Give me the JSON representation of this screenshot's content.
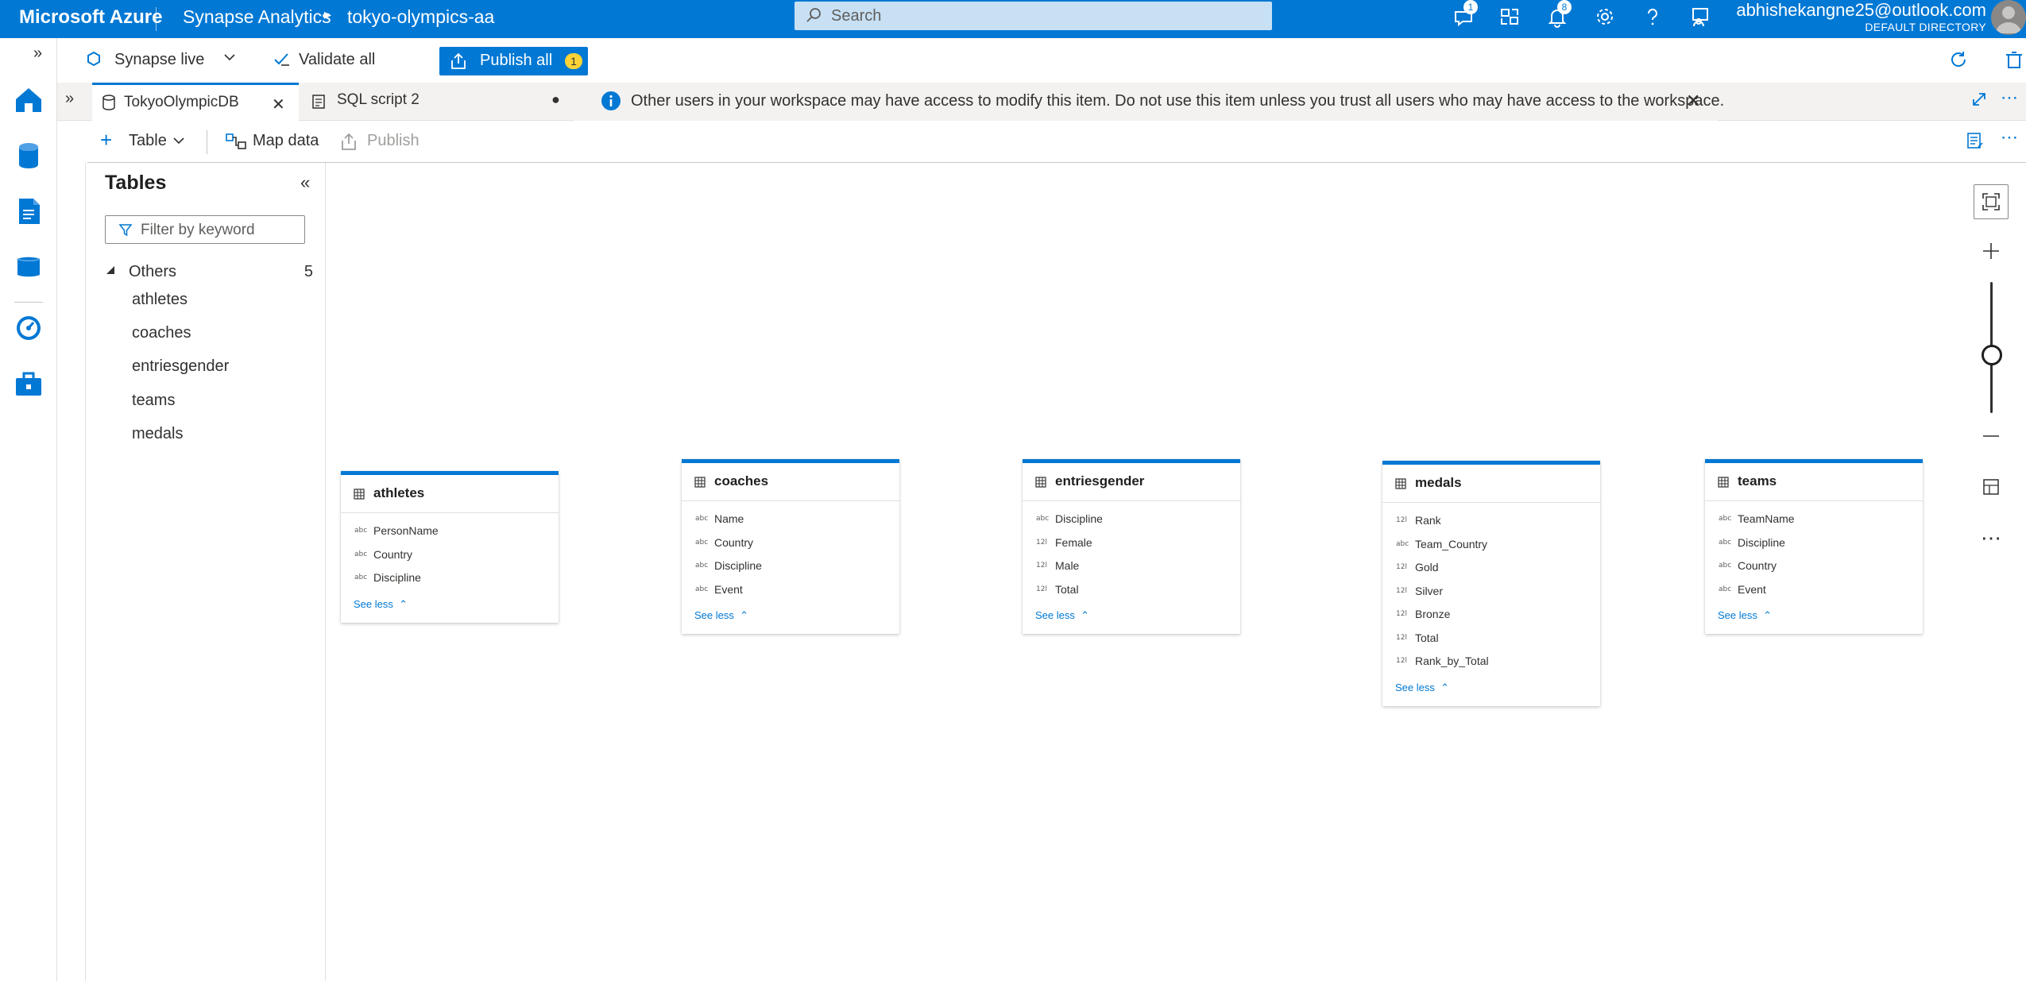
{
  "topbar": {
    "brand": "Microsoft Azure",
    "service": "Synapse Analytics",
    "workspace": "tokyo-olympics-aa",
    "search_placeholder": "Search",
    "feedback_badge": "1",
    "notifications_badge": "8",
    "account_email": "abhishekangne25@outlook.com",
    "account_directory": "DEFAULT DIRECTORY"
  },
  "cmdbar": {
    "live_label": "Synapse live",
    "validate_label": "Validate all",
    "publish_label": "Publish all",
    "publish_count": "1"
  },
  "tabs": [
    {
      "label": "TokyoOlympicDB",
      "active": true
    },
    {
      "label": "SQL script 2",
      "active": false,
      "dirty": true
    }
  ],
  "banner": {
    "text": "Other users in your workspace may have access to modify this item. Do not use this item unless you trust all users who may have access to the workspace."
  },
  "designer_toolbar": {
    "table_label": "Table",
    "map_data_label": "Map data",
    "publish_label": "Publish"
  },
  "tables_pane": {
    "title": "Tables",
    "filter_placeholder": "Filter by keyword",
    "group_label": "Others",
    "group_count": "5",
    "items": [
      "athletes",
      "coaches",
      "entriesgender",
      "teams",
      "medals"
    ]
  },
  "entities": [
    {
      "name": "athletes",
      "columns": [
        {
          "type": "abc",
          "name": "PersonName"
        },
        {
          "type": "abc",
          "name": "Country"
        },
        {
          "type": "abc",
          "name": "Discipline"
        }
      ],
      "see_less": "See less"
    },
    {
      "name": "coaches",
      "columns": [
        {
          "type": "abc",
          "name": "Name"
        },
        {
          "type": "abc",
          "name": "Country"
        },
        {
          "type": "abc",
          "name": "Discipline"
        },
        {
          "type": "abc",
          "name": "Event"
        }
      ],
      "see_less": "See less"
    },
    {
      "name": "entriesgender",
      "columns": [
        {
          "type": "abc",
          "name": "Discipline"
        },
        {
          "type": "12l",
          "name": "Female"
        },
        {
          "type": "12l",
          "name": "Male"
        },
        {
          "type": "12l",
          "name": "Total"
        }
      ],
      "see_less": "See less"
    },
    {
      "name": "medals",
      "columns": [
        {
          "type": "12l",
          "name": "Rank"
        },
        {
          "type": "abc",
          "name": "Team_Country"
        },
        {
          "type": "12l",
          "name": "Gold"
        },
        {
          "type": "12l",
          "name": "Silver"
        },
        {
          "type": "12l",
          "name": "Bronze"
        },
        {
          "type": "12l",
          "name": "Total"
        },
        {
          "type": "12l",
          "name": "Rank_by_Total"
        }
      ],
      "see_less": "See less"
    },
    {
      "name": "teams",
      "columns": [
        {
          "type": "abc",
          "name": "TeamName"
        },
        {
          "type": "abc",
          "name": "Discipline"
        },
        {
          "type": "abc",
          "name": "Country"
        },
        {
          "type": "abc",
          "name": "Event"
        }
      ],
      "see_less": "See less"
    }
  ],
  "colors": {
    "accent": "#0078d4",
    "badge": "#ffd335"
  }
}
